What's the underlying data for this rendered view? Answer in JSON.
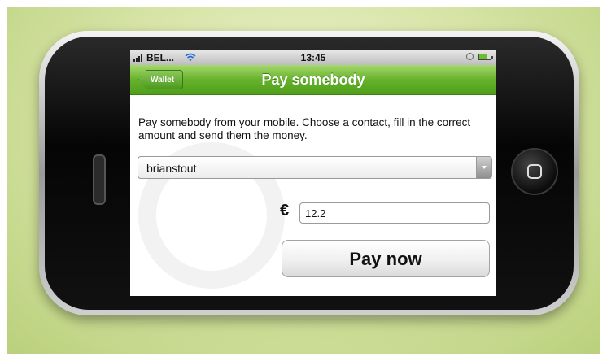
{
  "status_bar": {
    "carrier": "BEL...",
    "time": "13:45",
    "signal_icon": "signal-bars-icon",
    "wifi_icon": "wifi-icon",
    "battery_icon": "battery-icon"
  },
  "nav": {
    "back_label": "Wallet",
    "title": "Pay somebody"
  },
  "form": {
    "description": "Pay somebody from your mobile. Choose a contact, fill in the correct amount and send them the money.",
    "contact": "brianstout",
    "currency_symbol": "€",
    "amount": "12.2",
    "pay_button_label": "Pay now"
  },
  "colors": {
    "accent_green": "#66b22c",
    "background": "#d8e5a8"
  }
}
